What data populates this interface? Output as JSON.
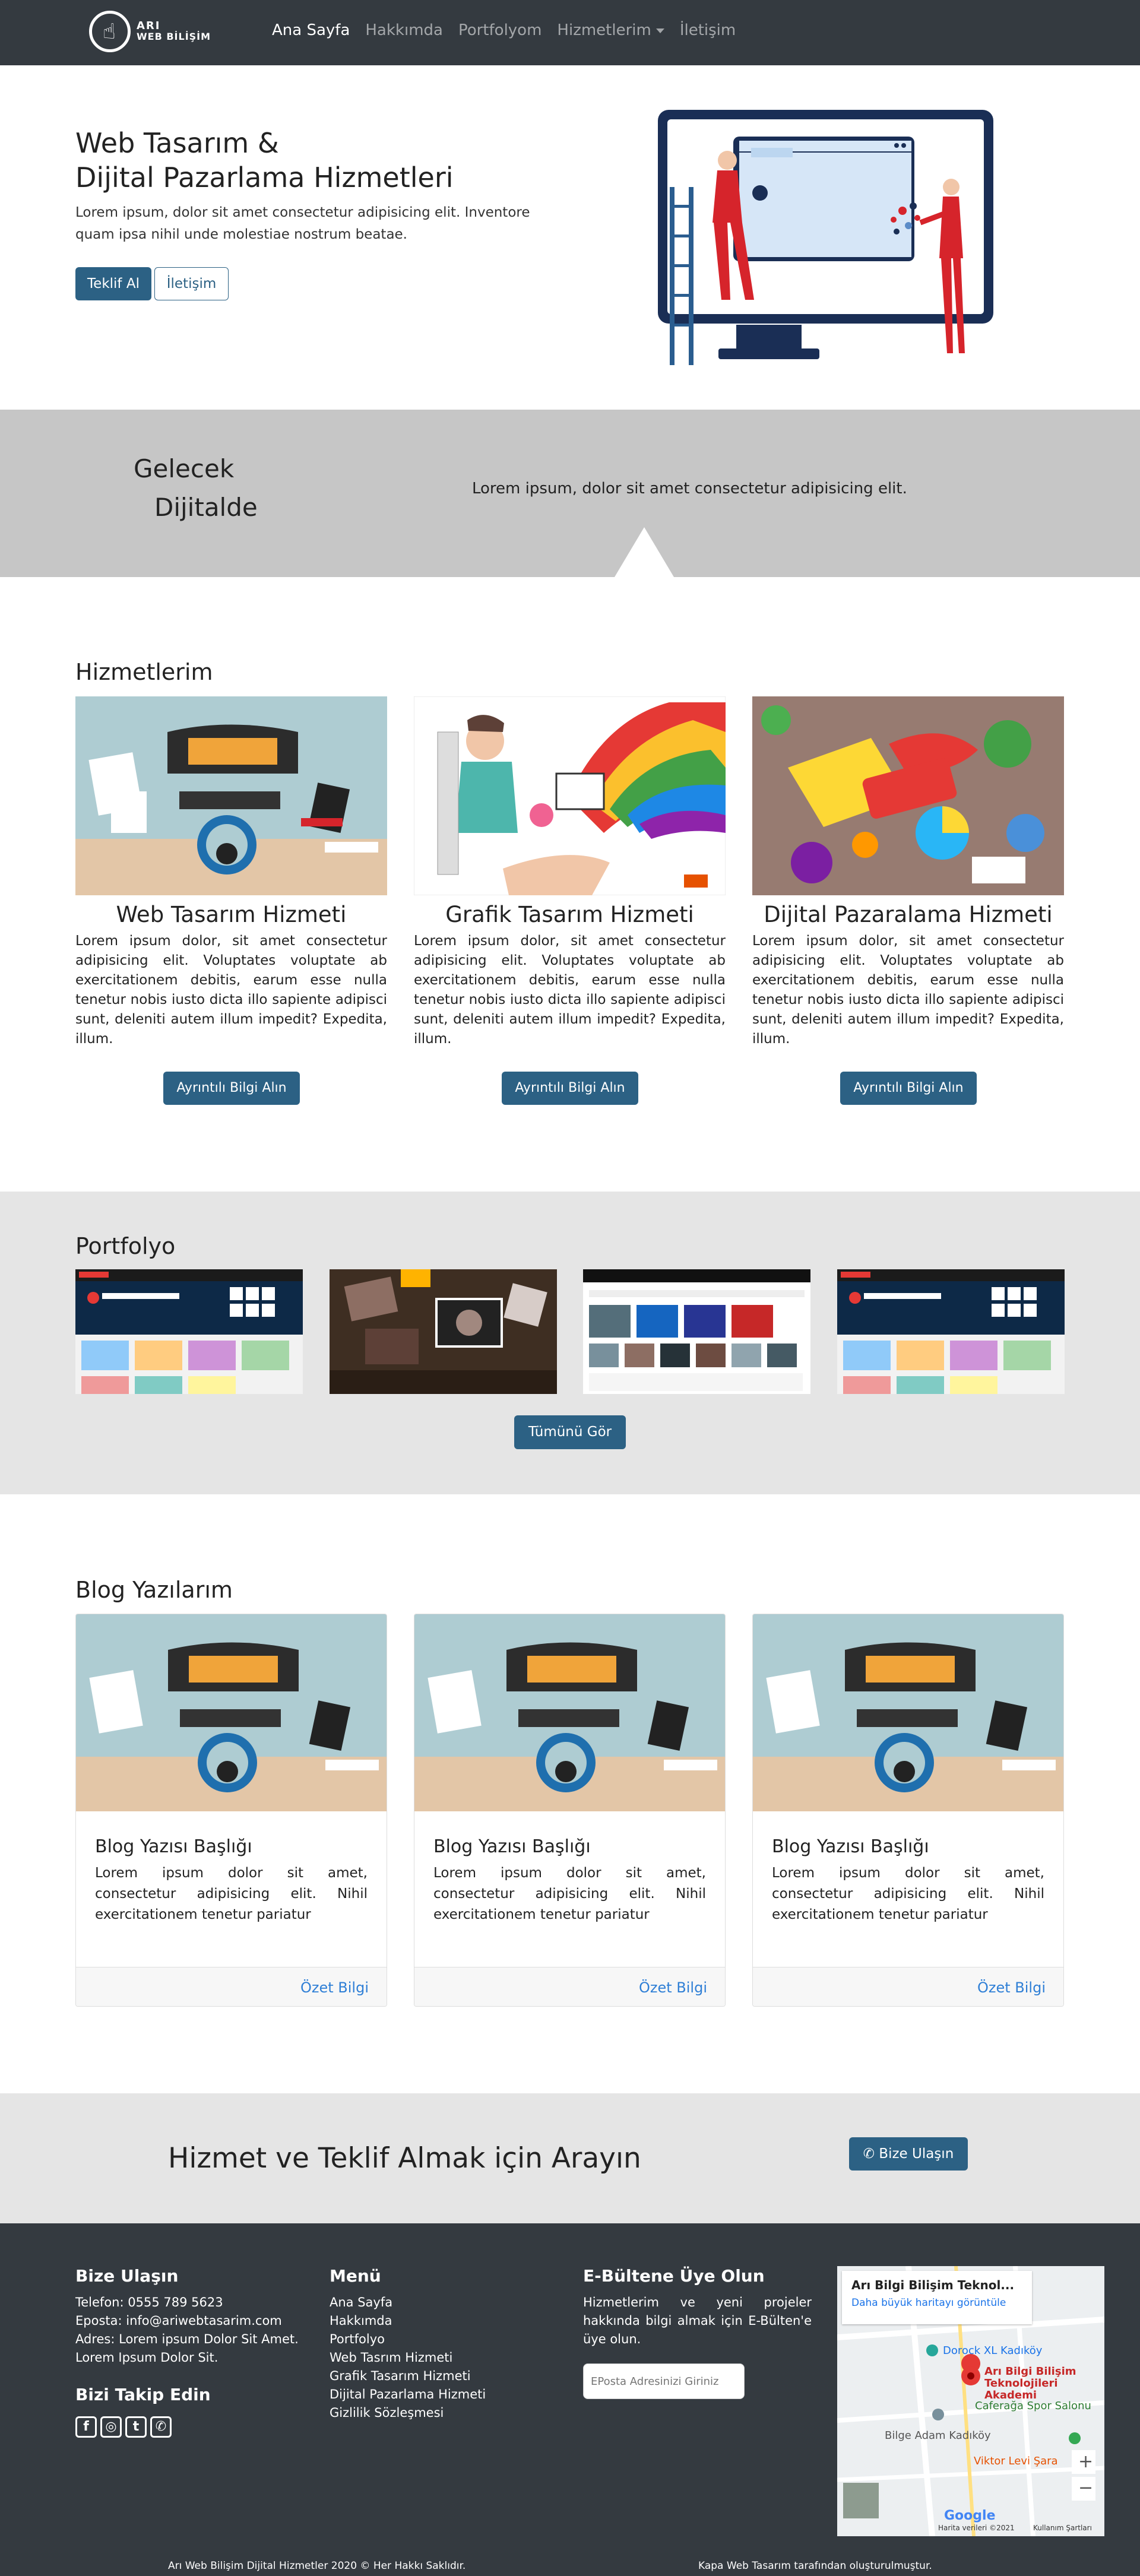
{
  "nav": {
    "brand_line1": "ARI",
    "brand_line2": "WEB BİLİŞİM",
    "links": [
      "Ana Sayfa",
      "Hakkımda",
      "Portfolyom",
      "Hizmetlerim",
      "İletişim"
    ]
  },
  "hero": {
    "title_line1": "Web Tasarım &",
    "title_line2": "Dijital Pazarlama Hizmetleri",
    "lead": "Lorem ipsum, dolor sit amet consectetur adipisicing elit. Inventore quam ipsa nihil unde molestiae nostrum beatae.",
    "primary_button": "Teklif Al",
    "secondary_button": "İletişim"
  },
  "band": {
    "line1": "Gelecek",
    "line2": "Dijitalde",
    "text": "Lorem ipsum, dolor sit amet consectetur adipisicing elit."
  },
  "services": {
    "title": "Hizmetlerim",
    "items": [
      {
        "title": "Web Tasarım Hizmeti",
        "text": "Lorem ipsum dolor, sit amet consectetur adipisicing elit. Voluptates voluptate ab exercitationem debitis, earum esse nulla tenetur nobis iusto dicta illo sapiente adipisci sunt, deleniti autem illum impedit? Expedita, illum.",
        "button": "Ayrıntılı Bilgi Alın"
      },
      {
        "title": "Grafik Tasarım Hizmeti",
        "text": "Lorem ipsum dolor, sit amet consectetur adipisicing elit. Voluptates voluptate ab exercitationem debitis, earum esse nulla tenetur nobis iusto dicta illo sapiente adipisci sunt, deleniti autem illum impedit? Expedita, illum.",
        "button": "Ayrıntılı Bilgi Alın"
      },
      {
        "title": "Dijital Pazaralama Hizmeti",
        "text": "Lorem ipsum dolor, sit amet consectetur adipisicing elit. Voluptates voluptate ab exercitationem debitis, earum esse nulla tenetur nobis iusto dicta illo sapiente adipisci sunt, deleniti autem illum impedit? Expedita, illum.",
        "button": "Ayrıntılı Bilgi Alın"
      }
    ]
  },
  "portfolio": {
    "title": "Portfolyo",
    "button": "Tümünü Gör",
    "site_headline": "Inspiring Talent. Exceptional Work.",
    "site_logo": "COROFLOT"
  },
  "blog": {
    "title": "Blog Yazılarım",
    "items": [
      {
        "title": "Blog Yazısı Başlığı",
        "text": "Lorem ipsum dolor sit amet, consectetur adipisicing elit. Nihil exercitationem tenetur pariatur",
        "link": "Özet Bilgi"
      },
      {
        "title": "Blog Yazısı Başlığı",
        "text": "Lorem ipsum dolor sit amet, consectetur adipisicing elit. Nihil exercitationem tenetur pariatur",
        "link": "Özet Bilgi"
      },
      {
        "title": "Blog Yazısı Başlığı",
        "text": "Lorem ipsum dolor sit amet, consectetur adipisicing elit. Nihil exercitationem tenetur pariatur",
        "link": "Özet Bilgi"
      }
    ]
  },
  "cta": {
    "text": "Hizmet ve Teklif Almak için Arayın",
    "button": "Bize Ulaşın"
  },
  "footer": {
    "contact_title": "Bize Ulaşın",
    "phone": "Telefon: 0555 789 5623",
    "email": "Eposta: info@ariwebtasarim.com",
    "address_line1": "Adres: Lorem ipsum Dolor Sit Amet.",
    "address_line2": "Lorem Ipsum Dolor Sit.",
    "follow_title": "Bizi Takip Edin",
    "menu_title": "Menü",
    "menu": [
      "Ana Sayfa",
      "Hakkımda",
      "Portfolyo",
      "Web Tasrım Hizmeti",
      "Grafik Tasarım Hizmeti",
      "Dijital Pazarlama Hizmeti",
      "Gizlilik Sözleşmesi"
    ],
    "newsletter_title": "E-Bültene Üye Olun",
    "newsletter_text": "Hizmetlerim ve yeni projeler hakkında bilgi almak için E-Bülten'e üye olun.",
    "newsletter_placeholder": "EPosta Adresinizi Giriniz",
    "map_title": "Arı Bilgi Bilişim Teknol...",
    "map_link": "Daha büyük haritayı görüntüle",
    "map_labels": [
      "Dorock XL Kadıköy",
      "Arı Bilgi Bilişim Teknolojileri Akademi",
      "Caferağa Spor Salonu",
      "Bilge Adam Kadıköy",
      "Viktor Levi Şara"
    ],
    "map_google": "Google",
    "map_data": "Harita verileri ©2021",
    "map_terms": "Kullanım Şartları",
    "copyright": "Arı Web Bilişim Dijital Hizmetler 2020 © Her Hakkı Saklıdır.",
    "credit": "Kapa Web Tasarım tarafından oluşturulmuştur."
  }
}
